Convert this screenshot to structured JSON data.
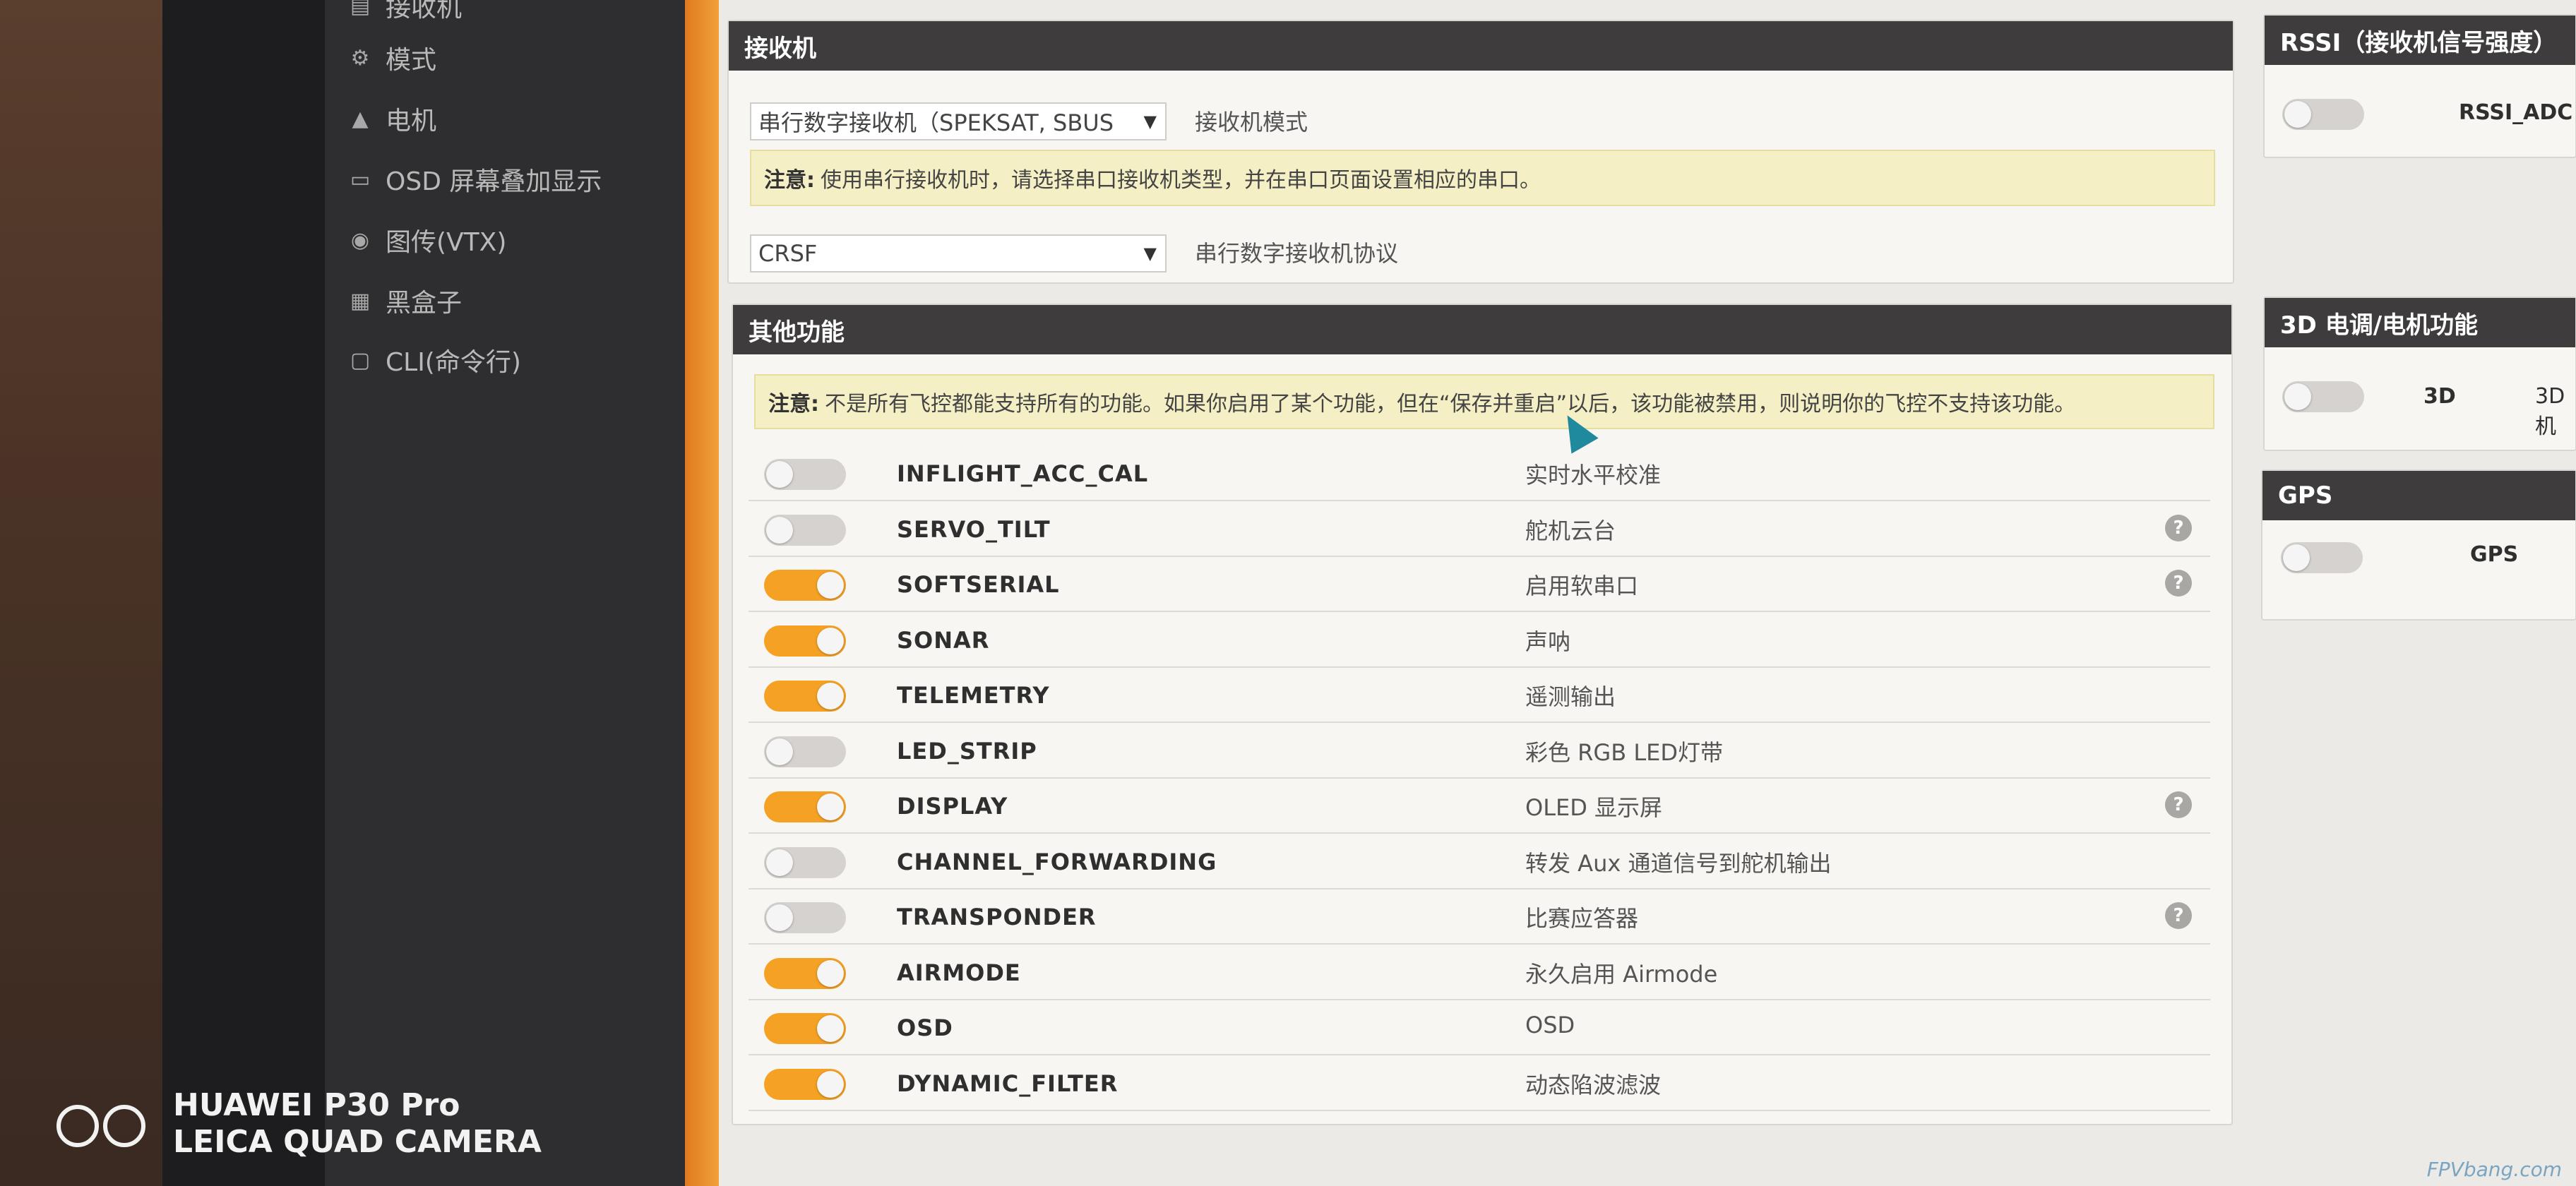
{
  "sidebar": {
    "items": [
      {
        "label": "接收机",
        "icon": "receiver-icon"
      },
      {
        "label": "模式",
        "icon": "modes-icon"
      },
      {
        "label": "电机",
        "icon": "motor-icon"
      },
      {
        "label": "OSD 屏幕叠加显示",
        "icon": "osd-icon"
      },
      {
        "label": "图传(VTX)",
        "icon": "vtx-icon"
      },
      {
        "label": "黑盒子",
        "icon": "blackbox-icon"
      },
      {
        "label": "CLI(命令行)",
        "icon": "cli-icon"
      }
    ]
  },
  "receiver": {
    "title": "接收机",
    "mode_value": "串行数字接收机（SPEKSAT, SBUS",
    "mode_label": "接收机模式",
    "note_prefix": "注意:",
    "note_text": "使用串行接收机时，请选择串口接收机类型，并在串口页面设置相应的串口。",
    "protocol_value": "CRSF",
    "protocol_label": "串行数字接收机协议"
  },
  "other_features": {
    "title": "其他功能",
    "note_prefix": "注意:",
    "note_text": "不是所有飞控都能支持所有的功能。如果你启用了某个功能，但在“保存并重启”以后，该功能被禁用，则说明你的飞控不支持该功能。",
    "features": [
      {
        "name": "INFLIGHT_ACC_CAL",
        "desc": "实时水平校准",
        "on": false,
        "help": false
      },
      {
        "name": "SERVO_TILT",
        "desc": "舵机云台",
        "on": false,
        "help": true
      },
      {
        "name": "SOFTSERIAL",
        "desc": "启用软串口",
        "on": true,
        "help": true
      },
      {
        "name": "SONAR",
        "desc": "声呐",
        "on": true,
        "help": false
      },
      {
        "name": "TELEMETRY",
        "desc": "遥测输出",
        "on": true,
        "help": false
      },
      {
        "name": "LED_STRIP",
        "desc": "彩色 RGB LED灯带",
        "on": false,
        "help": false
      },
      {
        "name": "DISPLAY",
        "desc": "OLED 显示屏",
        "on": true,
        "help": true
      },
      {
        "name": "CHANNEL_FORWARDING",
        "desc": "转发 Aux 通道信号到舵机输出",
        "on": false,
        "help": false
      },
      {
        "name": "TRANSPONDER",
        "desc": "比赛应答器",
        "on": false,
        "help": true
      },
      {
        "name": "AIRMODE",
        "desc": "永久启用 Airmode",
        "on": true,
        "help": false
      },
      {
        "name": "OSD",
        "desc": "OSD",
        "on": true,
        "help": false
      },
      {
        "name": "DYNAMIC_FILTER",
        "desc": "动态陷波滤波",
        "on": true,
        "help": false
      }
    ]
  },
  "rssi": {
    "title": "RSSI（接收机信号强度）",
    "toggle_label": "RSSI_ADC",
    "on": false
  },
  "esc3d": {
    "title": "3D 电调/电机功能",
    "toggle_label": "3D",
    "extra_label": "3D 机",
    "on": false
  },
  "gps": {
    "title": "GPS",
    "toggle_label": "GPS",
    "on": false
  },
  "help_symbol": "?",
  "dropdown_arrow": "▼",
  "watermark": {
    "line1": "HUAWEI P30 Pro",
    "line2": "LEICA QUAD CAMERA"
  },
  "site_mark": "FPVbang.com"
}
